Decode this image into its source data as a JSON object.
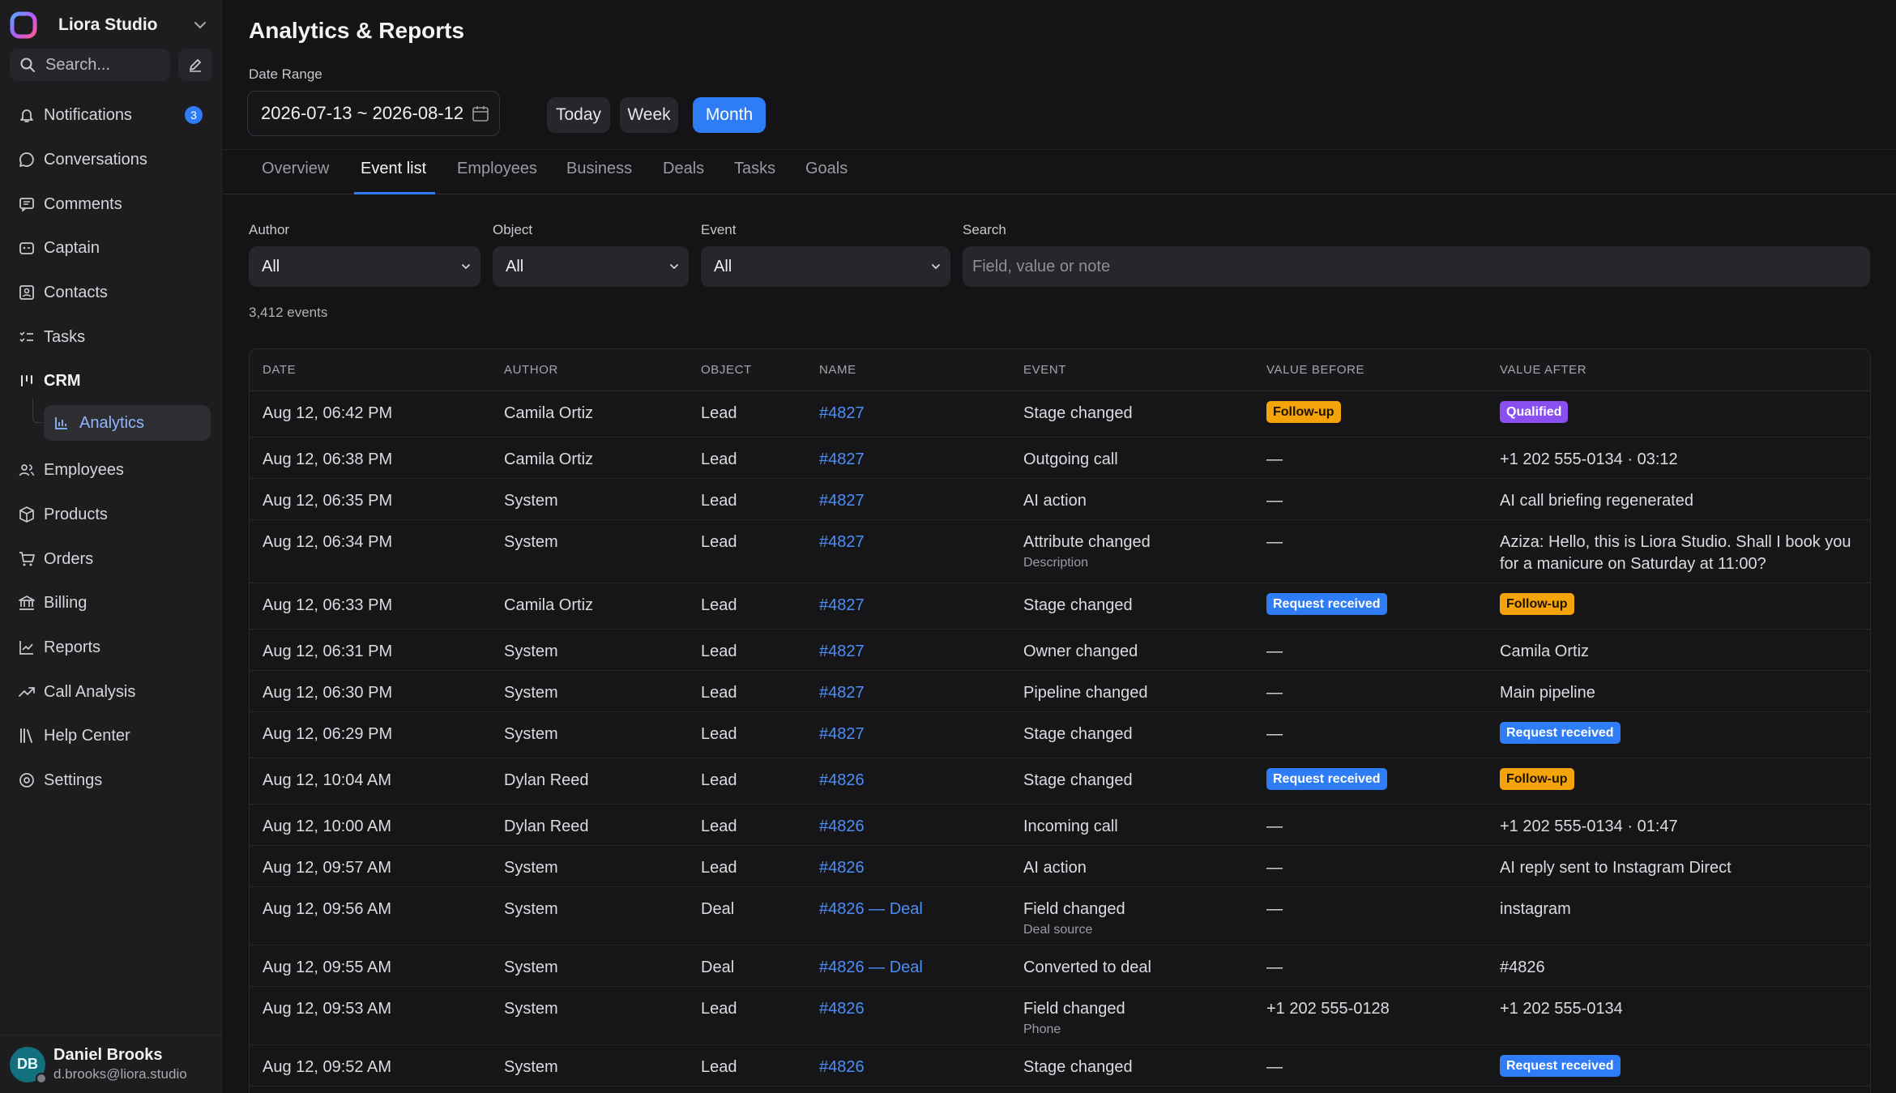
{
  "workspace": {
    "name": "Liora Studio"
  },
  "sidebar": {
    "search_placeholder": "Search...",
    "notifications_badge": "3",
    "items": [
      {
        "label": "Notifications",
        "icon": "bell-icon"
      },
      {
        "label": "Conversations",
        "icon": "chat-bubble-icon"
      },
      {
        "label": "Comments",
        "icon": "comment-icon"
      },
      {
        "label": "Captain",
        "icon": "bot-icon"
      },
      {
        "label": "Contacts",
        "icon": "contact-card-icon"
      },
      {
        "label": "Tasks",
        "icon": "checklist-icon"
      },
      {
        "label": "CRM",
        "icon": "kanban-icon"
      },
      {
        "label": "Analytics",
        "icon": "bar-chart-icon"
      },
      {
        "label": "Employees",
        "icon": "users-icon"
      },
      {
        "label": "Products",
        "icon": "box-icon"
      },
      {
        "label": "Orders",
        "icon": "cart-icon"
      },
      {
        "label": "Billing",
        "icon": "bank-icon"
      },
      {
        "label": "Reports",
        "icon": "line-chart-icon"
      },
      {
        "label": "Call Analysis",
        "icon": "trend-icon"
      },
      {
        "label": "Help Center",
        "icon": "library-icon"
      },
      {
        "label": "Settings",
        "icon": "settings-icon"
      }
    ]
  },
  "user": {
    "initials": "DB",
    "name": "Daniel Brooks",
    "email": "d.brooks@liora.studio"
  },
  "page": {
    "title": "Analytics & Reports",
    "date_range_label": "Date Range",
    "date_range_value": "2026-07-13 ~ 2026-08-12",
    "periods": [
      "Today",
      "Week",
      "Month"
    ],
    "active_period": "Month"
  },
  "tabs": [
    "Overview",
    "Event list",
    "Employees",
    "Business",
    "Deals",
    "Tasks",
    "Goals"
  ],
  "active_tab": "Event list",
  "filters": {
    "author": {
      "label": "Author",
      "value": "All"
    },
    "object": {
      "label": "Object",
      "value": "All"
    },
    "event": {
      "label": "Event",
      "value": "All"
    },
    "search": {
      "label": "Search",
      "placeholder": "Field, value or note"
    }
  },
  "events_count": "3,412 events",
  "table": {
    "columns": [
      "DATE",
      "AUTHOR",
      "OBJECT",
      "NAME",
      "EVENT",
      "VALUE BEFORE",
      "VALUE AFTER"
    ],
    "rows": [
      {
        "date": "Aug 12, 06:42 PM",
        "author": "Camila Ortiz",
        "object": "Lead",
        "name": "#4827",
        "event": "Stage changed",
        "event_sub": "",
        "before": "Follow-up",
        "before_tag": "orange",
        "after": "Qualified",
        "after_tag": "purple"
      },
      {
        "date": "Aug 12, 06:38 PM",
        "author": "Camila Ortiz",
        "object": "Lead",
        "name": "#4827",
        "event": "Outgoing call",
        "event_sub": "",
        "before": "—",
        "before_tag": "",
        "after": "+1 202 555-0134 · 03:12",
        "after_tag": ""
      },
      {
        "date": "Aug 12, 06:35 PM",
        "author": "System",
        "object": "Lead",
        "name": "#4827",
        "event": "AI action",
        "event_sub": "",
        "before": "—",
        "before_tag": "",
        "after": "AI call briefing regenerated",
        "after_tag": ""
      },
      {
        "date": "Aug 12, 06:34 PM",
        "author": "System",
        "object": "Lead",
        "name": "#4827",
        "event": "Attribute changed",
        "event_sub": "Description",
        "before": "—",
        "before_tag": "",
        "after": "Aziza: Hello, this is Liora Studio. Shall I book you for a manicure on Saturday at 11:00?",
        "after_tag": ""
      },
      {
        "date": "Aug 12, 06:33 PM",
        "author": "Camila Ortiz",
        "object": "Lead",
        "name": "#4827",
        "event": "Stage changed",
        "event_sub": "",
        "before": "Request received",
        "before_tag": "blue",
        "after": "Follow-up",
        "after_tag": "orange"
      },
      {
        "date": "Aug 12, 06:31 PM",
        "author": "System",
        "object": "Lead",
        "name": "#4827",
        "event": "Owner changed",
        "event_sub": "",
        "before": "—",
        "before_tag": "",
        "after": "Camila Ortiz",
        "after_tag": ""
      },
      {
        "date": "Aug 12, 06:30 PM",
        "author": "System",
        "object": "Lead",
        "name": "#4827",
        "event": "Pipeline changed",
        "event_sub": "",
        "before": "—",
        "before_tag": "",
        "after": "Main pipeline",
        "after_tag": ""
      },
      {
        "date": "Aug 12, 06:29 PM",
        "author": "System",
        "object": "Lead",
        "name": "#4827",
        "event": "Stage changed",
        "event_sub": "",
        "before": "—",
        "before_tag": "",
        "after": "Request received",
        "after_tag": "blue"
      },
      {
        "date": "Aug 12, 10:04 AM",
        "author": "Dylan Reed",
        "object": "Lead",
        "name": "#4826",
        "event": "Stage changed",
        "event_sub": "",
        "before": "Request received",
        "before_tag": "blue",
        "after": "Follow-up",
        "after_tag": "orange"
      },
      {
        "date": "Aug 12, 10:00 AM",
        "author": "Dylan Reed",
        "object": "Lead",
        "name": "#4826",
        "event": "Incoming call",
        "event_sub": "",
        "before": "—",
        "before_tag": "",
        "after": "+1 202 555-0134 · 01:47",
        "after_tag": ""
      },
      {
        "date": "Aug 12, 09:57 AM",
        "author": "System",
        "object": "Lead",
        "name": "#4826",
        "event": "AI action",
        "event_sub": "",
        "before": "—",
        "before_tag": "",
        "after": "AI reply sent to Instagram Direct",
        "after_tag": ""
      },
      {
        "date": "Aug 12, 09:56 AM",
        "author": "System",
        "object": "Deal",
        "name": "#4826 — Deal",
        "event": "Field changed",
        "event_sub": "Deal source",
        "before": "—",
        "before_tag": "",
        "after": "instagram",
        "after_tag": ""
      },
      {
        "date": "Aug 12, 09:55 AM",
        "author": "System",
        "object": "Deal",
        "name": "#4826 — Deal",
        "event": "Converted to deal",
        "event_sub": "",
        "before": "—",
        "before_tag": "",
        "after": "#4826",
        "after_tag": ""
      },
      {
        "date": "Aug 12, 09:53 AM",
        "author": "System",
        "object": "Lead",
        "name": "#4826",
        "event": "Field changed",
        "event_sub": "Phone",
        "before": "+1 202 555-0128",
        "before_tag": "",
        "after": "+1 202 555-0134",
        "after_tag": ""
      },
      {
        "date": "Aug 12, 09:52 AM",
        "author": "System",
        "object": "Lead",
        "name": "#4826",
        "event": "Stage changed",
        "event_sub": "",
        "before": "—",
        "before_tag": "",
        "after": "Request received",
        "after_tag": "blue"
      }
    ]
  }
}
